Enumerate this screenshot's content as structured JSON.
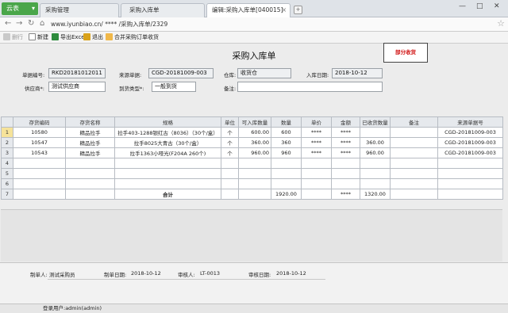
{
  "app": {
    "brand": "云表"
  },
  "tabs": [
    {
      "label": "采购管理"
    },
    {
      "label": "采购入库单"
    },
    {
      "label": "编辑:采购入库单[040015]"
    }
  ],
  "address": {
    "url": "www.iyunbiao.cn/ **** /采购入库单/2329"
  },
  "toolbar": {
    "items": [
      {
        "label": "删行",
        "icon": "delete-row-icon",
        "enabled": false
      },
      {
        "label": "新建",
        "icon": "new-doc-icon",
        "enabled": true
      },
      {
        "label": "导出Excel",
        "icon": "excel-icon",
        "enabled": true
      },
      {
        "label": "退出",
        "icon": "exit-icon",
        "enabled": true
      },
      {
        "label": "合并采购订单收货",
        "icon": "folder-icon",
        "enabled": true
      }
    ]
  },
  "form": {
    "title": "采购入库单",
    "status": "部分收货",
    "fields": {
      "doc_no_label": "单据编号:",
      "doc_no": "RKD20181012011",
      "source_no_label": "来源单据:",
      "source_no": "CGD-20181009-003",
      "warehouse_label": "仓库:",
      "warehouse": "收货仓",
      "date_label": "入库日期:",
      "date": "2018-10-12",
      "supplier_label": "供应商*:",
      "supplier": "测试供应商",
      "arrival_type_label": "到货类型*:",
      "arrival_type": "一般到货",
      "remark_label": "备注:",
      "remark": ""
    }
  },
  "grid": {
    "columns": [
      "存货编码",
      "存货名称",
      "规格",
      "单位",
      "可入库数量",
      "数量",
      "单价",
      "金额",
      "已收货数量",
      "备注",
      "来源单据号"
    ],
    "rows": [
      {
        "n": "1",
        "code": "10580",
        "name": "精品拉手",
        "spec": "拉手403-1288银红古（8036）（30个/盒）",
        "unit": "个",
        "avail": "600.00",
        "qty": "600",
        "price": "****",
        "amount": "****",
        "received": "",
        "remark": "",
        "source": "CGD-20181009-003"
      },
      {
        "n": "2",
        "code": "10547",
        "name": "精品拉手",
        "spec": "拉手8025大青古（30个/盒）",
        "unit": "个",
        "avail": "360.00",
        "qty": "360",
        "price": "****",
        "amount": "****",
        "received": "360.00",
        "remark": "",
        "source": "CGD-20181009-003"
      },
      {
        "n": "3",
        "code": "10543",
        "name": "精品拉手",
        "spec": "拉手1363小哑光(F204A 260个)",
        "unit": "个",
        "avail": "960.00",
        "qty": "960",
        "price": "****",
        "amount": "****",
        "received": "960.00",
        "remark": "",
        "source": "CGD-20181009-003"
      },
      {
        "n": "4",
        "code": "",
        "name": "",
        "spec": "",
        "unit": "",
        "avail": "",
        "qty": "",
        "price": "",
        "amount": "",
        "received": "",
        "remark": "",
        "source": ""
      },
      {
        "n": "5",
        "code": "",
        "name": "",
        "spec": "",
        "unit": "",
        "avail": "",
        "qty": "",
        "price": "",
        "amount": "",
        "received": "",
        "remark": "",
        "source": ""
      },
      {
        "n": "6",
        "code": "",
        "name": "",
        "spec": "",
        "unit": "",
        "avail": "",
        "qty": "",
        "price": "",
        "amount": "",
        "received": "",
        "remark": "",
        "source": ""
      }
    ],
    "total": {
      "n": "7",
      "label": "合计",
      "qty": "1920.00",
      "amount": "****",
      "received": "1320.00"
    }
  },
  "footer": {
    "maker_label": "制单人:",
    "maker": "测试采购员",
    "make_date_label": "制单日期:",
    "make_date": "2018-10-12",
    "auditor_label": "审核人:",
    "auditor": "LT-0013",
    "audit_date_label": "审核日期:",
    "audit_date": "2018-10-12"
  },
  "statusbar": {
    "login": "登录用户:admin(admin)"
  },
  "colors": {
    "brand": "#4aa64a",
    "status": "#d01010",
    "row_highlight": "#f6e39a"
  }
}
